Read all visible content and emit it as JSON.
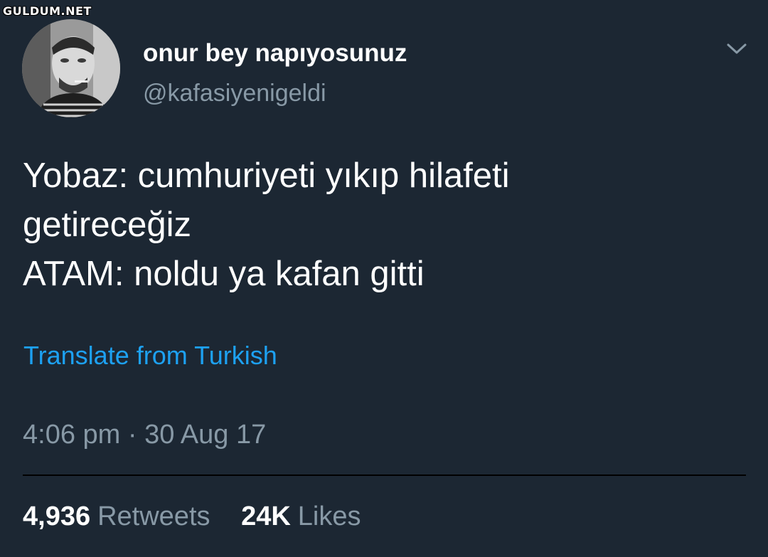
{
  "watermark": "GULDUM.NET",
  "user": {
    "display_name": "onur bey napıyosunuz",
    "handle": "@kafasiyenigeldi"
  },
  "tweet": {
    "lines": [
      "Yobaz: cumhuriyeti yıkıp hilafeti",
      "getireceğiz",
      "ATAM: noldu ya kafan gitti"
    ],
    "translate_label": "Translate from Turkish",
    "timestamp": "4:06 pm · 30 Aug 17"
  },
  "stats": {
    "retweets_count": "4,936",
    "retweets_label": "Retweets",
    "likes_count": "24K",
    "likes_label": "Likes"
  },
  "icons": {
    "menu": "chevron-down-icon"
  },
  "colors": {
    "background": "#1c2733",
    "primary_text": "#ffffff",
    "secondary_text": "#8899a6",
    "link": "#1da1f2"
  }
}
